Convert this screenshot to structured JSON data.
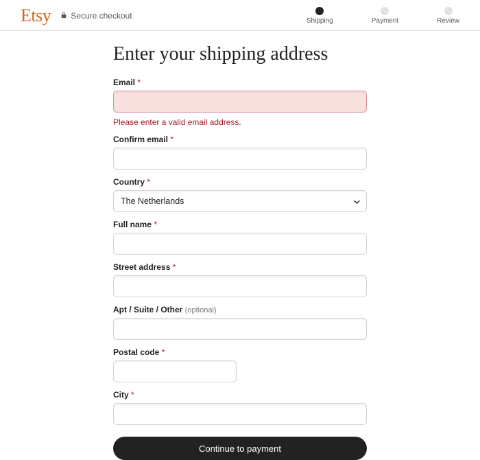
{
  "header": {
    "logo_text": "Etsy",
    "secure_label": "Secure checkout",
    "steps": [
      {
        "label": "Shipping",
        "active": true
      },
      {
        "label": "Payment",
        "active": false
      },
      {
        "label": "Review",
        "active": false
      }
    ]
  },
  "page_title": "Enter your shipping address",
  "form": {
    "email": {
      "label": "Email",
      "required": true,
      "value": "",
      "error": "Please enter a valid email address."
    },
    "confirm_email": {
      "label": "Confirm email",
      "required": true,
      "value": ""
    },
    "country": {
      "label": "Country",
      "required": true,
      "value": "The Netherlands"
    },
    "full_name": {
      "label": "Full name",
      "required": true,
      "value": ""
    },
    "street": {
      "label": "Street address",
      "required": true,
      "value": ""
    },
    "apt": {
      "label": "Apt / Suite / Other",
      "optional_text": "(optional)",
      "value": ""
    },
    "postal": {
      "label": "Postal code",
      "required": true,
      "value": ""
    },
    "city": {
      "label": "City",
      "required": true,
      "value": ""
    }
  },
  "submit_label": "Continue to payment",
  "required_marker": "*"
}
